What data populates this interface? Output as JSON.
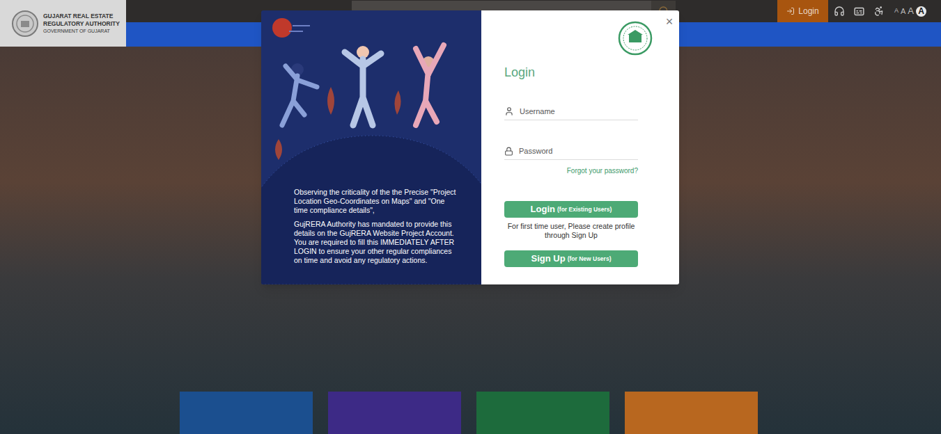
{
  "header": {
    "org_name": [
      "GUJARAT REAL ESTATE",
      "REGULATORY AUTHORITY"
    ],
    "org_sub": "GOVERNMENT OF GUJARAT",
    "login": "Login",
    "font_sizes": [
      {
        "label": "A",
        "selected": false
      },
      {
        "label": "A",
        "selected": false
      },
      {
        "label": "A",
        "selected": false
      },
      {
        "label": "A",
        "selected": true
      }
    ]
  },
  "tiles": [
    {
      "color": "#1b4f8f"
    },
    {
      "color": "#3d2a86"
    },
    {
      "color": "#1d6b3c"
    },
    {
      "color": "#b8671f"
    }
  ],
  "modal": {
    "close": "×",
    "notice": [
      "Observing the criticality of the the Precise \"Project Location Geo-Coordinates on Maps\" and \"One time compliance details\",",
      "GujRERA Authority has mandated to provide this details on the GujRERA Website Project Account. You are required to fill this IMMEDIATELY AFTER LOGIN to ensure your other regular compliances on time and avoid any regulatory actions."
    ],
    "title": "Login",
    "fields": [
      {
        "placeholder": "Username",
        "kind": "text"
      },
      {
        "placeholder": "Password",
        "kind": "password"
      }
    ],
    "forgot": "Forgot your password?",
    "login_button": {
      "label": "Login",
      "note": "(for Existing Users)"
    },
    "signup_hint": "For first time user, Please create profile through Sign Up",
    "signup_button": {
      "label": "Sign Up",
      "note": "(for New Users)"
    }
  }
}
